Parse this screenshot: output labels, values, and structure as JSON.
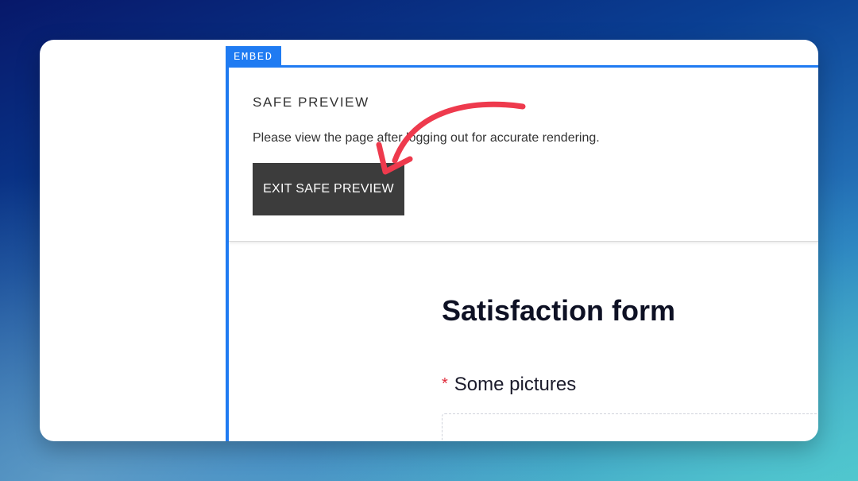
{
  "embed": {
    "tag_label": "EMBED",
    "accent_color": "#1f7bf2"
  },
  "safe_preview": {
    "title": "SAFE PREVIEW",
    "description": "Please view the page after logging out for accurate rendering.",
    "exit_button_label": "EXIT SAFE PREVIEW"
  },
  "form": {
    "title": "Satisfaction form",
    "fields": [
      {
        "label": "Some pictures",
        "required_mark": "*",
        "required": true
      }
    ]
  },
  "annotation": {
    "arrow_color": "#ee3a4d",
    "icon": "curved-arrow-icon"
  }
}
